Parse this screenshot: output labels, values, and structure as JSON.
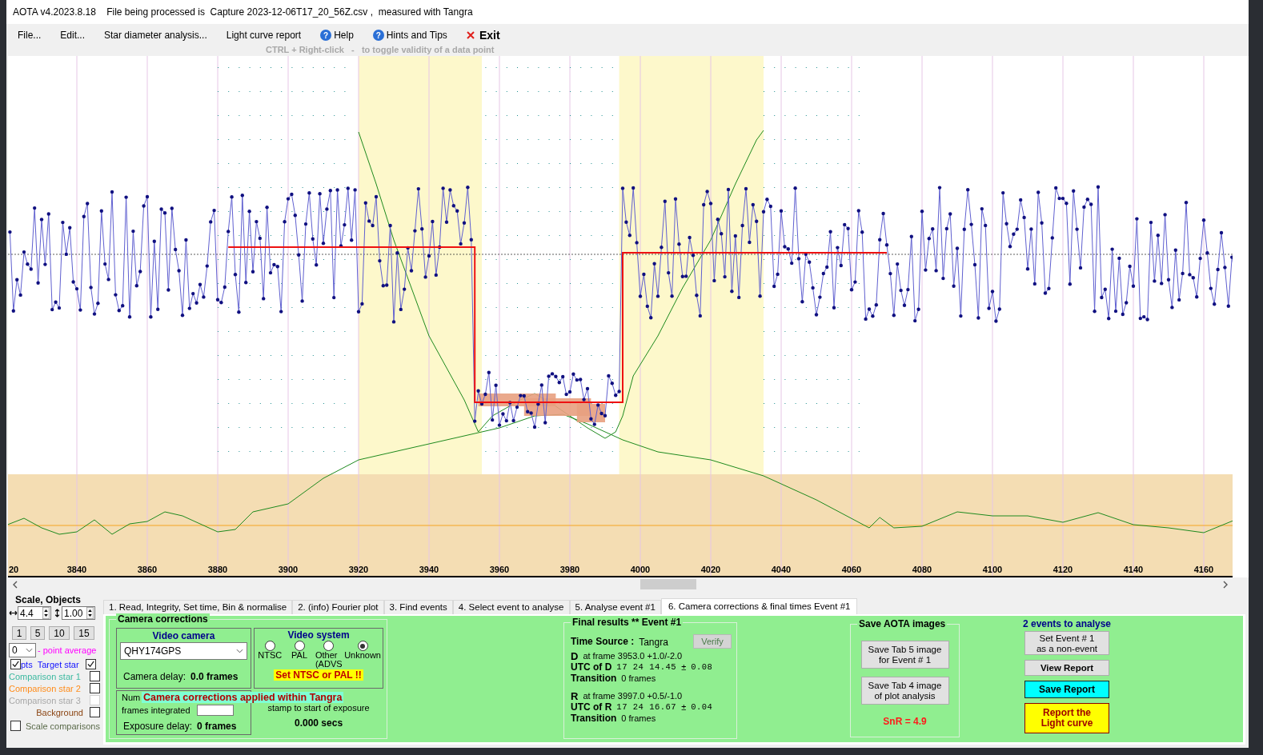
{
  "window": {
    "title": "AOTA v4.2023.8.18    File being processed is  Capture 2023-12-06T17_20_56Z.csv ,  measured with Tangra"
  },
  "menu": [
    {
      "label": "File...",
      "kind": "plain"
    },
    {
      "label": "Edit...",
      "kind": "plain"
    },
    {
      "label": "Star diameter analysis...",
      "kind": "plain"
    },
    {
      "label": "Light curve report",
      "kind": "plain"
    },
    {
      "label": "Help",
      "kind": "help",
      "glyph": "?"
    },
    {
      "label": "Hints and Tips",
      "kind": "help",
      "glyph": "?"
    },
    {
      "label": "Exit",
      "kind": "exit"
    }
  ],
  "hint": "CTRL + Right-click   -   to toggle validity of a data point",
  "plot": {
    "x_tick_labels": [
      "20",
      "3840",
      "3860",
      "3880",
      "3900",
      "3920",
      "3940",
      "3960",
      "3980",
      "4000",
      "4020",
      "4040",
      "4060",
      "4080",
      "4100",
      "4120",
      "4140",
      "4160"
    ]
  },
  "scale_objects": {
    "title": "Scale,  Objects",
    "x_scale": "4.4",
    "y_scale": "1.00",
    "buttons": [
      "1",
      "5",
      "10",
      "15"
    ],
    "average": "0",
    "average_label": "- point average",
    "pts": {
      "label": "pts",
      "checked": true
    },
    "objects": [
      {
        "label": "Target star",
        "color": "#1010ff",
        "checked": true,
        "disabled": false
      },
      {
        "label": "Comparison star 1",
        "color": "#3cb9a0",
        "checked": false,
        "disabled": false
      },
      {
        "label": "Comparison star 2",
        "color": "#ff8c1a",
        "checked": false,
        "disabled": false
      },
      {
        "label": "Comparison star 3",
        "color": "#a8a8a8",
        "checked": false,
        "disabled": true
      },
      {
        "label": "Background",
        "color": "#8b4513",
        "checked": false,
        "disabled": false
      }
    ],
    "scale_comparisons": {
      "label": "Scale comparisons",
      "checked": false
    }
  },
  "tabs": [
    {
      "label": "1.  Read, Integrity, Set time, Bin & normalise",
      "selected": false
    },
    {
      "label": "2. (info)  Fourier plot",
      "selected": false
    },
    {
      "label": "3. Find events",
      "selected": false
    },
    {
      "label": "4. Select event to analyse",
      "selected": false
    },
    {
      "label": "5. Analyse event #1",
      "selected": false
    },
    {
      "label": "6. Camera corrections & final times Event #1",
      "selected": true
    }
  ],
  "camera_corrections": {
    "title": "Camera corrections",
    "video_camera": {
      "title": "Video camera",
      "value": "QHY174GPS",
      "delay_label": "Camera delay:",
      "delay_value": "0.0 frames"
    },
    "video_system": {
      "title": "Video system",
      "options": [
        {
          "label": "NTSC",
          "selected": false
        },
        {
          "label": "PAL",
          "selected": false
        },
        {
          "label": "Other\n(ADVS",
          "selected": false
        },
        {
          "label": "Unknown",
          "selected": true
        }
      ],
      "warning": "Set NTSC or PAL !!"
    },
    "integration": {
      "label_top": "Num",
      "label": "frames integrated",
      "delay_label": "Exposure delay:",
      "delay_value": "0 frames"
    },
    "time_difference": {
      "line2": "stamp to start of exposure",
      "value": "0.000 secs"
    },
    "overlay": "Camera corrections applied within Tangra"
  },
  "final_results": {
    "title": "Final results  **  Event #1",
    "verify": "Verify",
    "time_source_label": "Time Source :",
    "time_source": "Tangra",
    "events": [
      {
        "letter": "D",
        "frame": "at frame 3953.0  +1.0/-2.0",
        "utc_label": "UTC of D",
        "utc": "17 24 14.45",
        "pm": "±",
        "err": "0.08",
        "transition_label": "Transition",
        "transition": "0 frames"
      },
      {
        "letter": "R",
        "frame": "at frame 3997.0  +0.5/-1.0",
        "utc_label": "UTC of R",
        "utc": "17 24 16.67",
        "pm": "±",
        "err": "0.04",
        "transition_label": "Transition",
        "transition": "0 frames"
      }
    ]
  },
  "save_images": {
    "title": "Save AOTA images",
    "buttons": [
      "Save Tab 5 image\nfor Event # 1",
      "Save Tab 4 image\nof plot analysis"
    ],
    "snr": "SnR = 4.9"
  },
  "events_panel": {
    "title": "2 events to analyse",
    "buttons": [
      {
        "label": "Set Event # 1\nas a non-event",
        "kind": "plain"
      },
      {
        "label": "View Report",
        "kind": "bold"
      },
      {
        "label": "Save Report",
        "kind": "cyan"
      },
      {
        "label": "Report the\nLight curve",
        "kind": "yellow"
      }
    ]
  }
}
